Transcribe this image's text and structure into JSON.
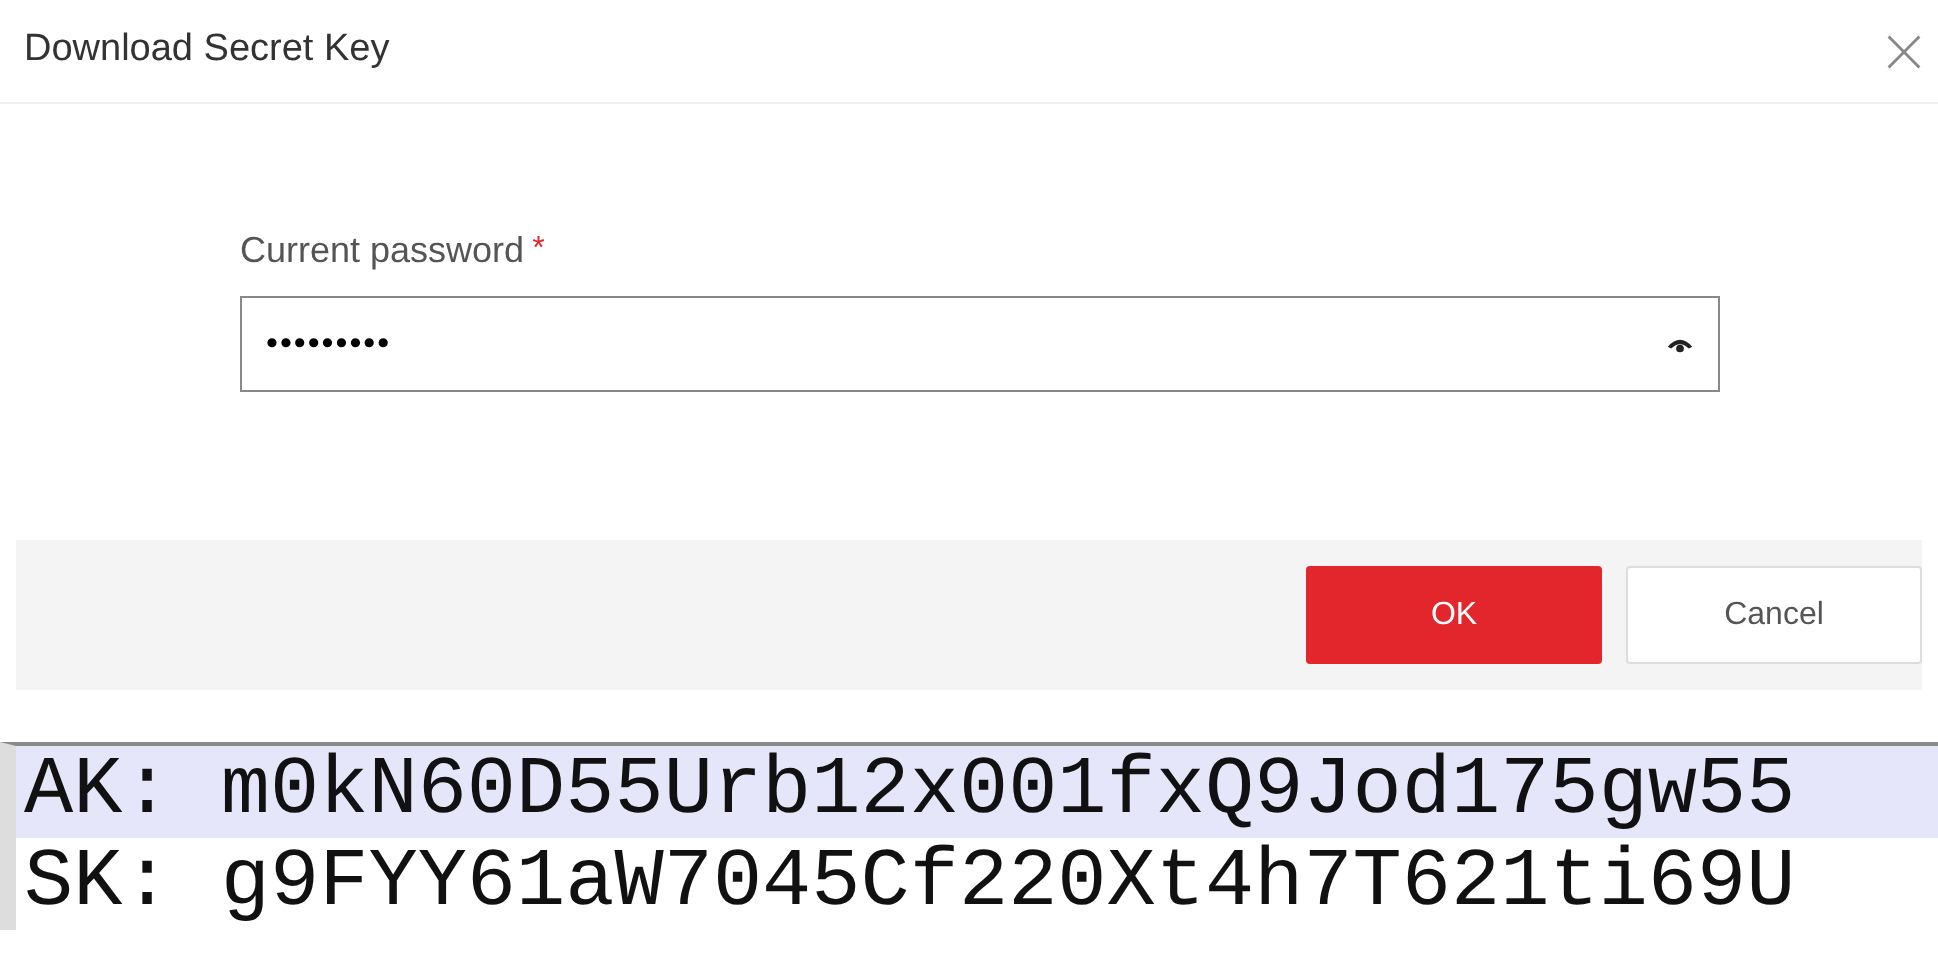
{
  "dialog": {
    "title": "Download Secret Key",
    "field": {
      "label": "Current password",
      "required": true,
      "required_mark": "*",
      "value": "•••••••••"
    },
    "buttons": [
      {
        "label": "OK",
        "kind": "primary"
      },
      {
        "label": "Cancel",
        "kind": "secondary"
      }
    ]
  },
  "keys": [
    {
      "text": "AK: m0kN60D55Urb12x001fxQ9Jod175gw55",
      "selected": true
    },
    {
      "text": "SK: g9FYY61aW7045Cf220Xt4h7T621ti69U",
      "selected": false
    }
  ]
}
